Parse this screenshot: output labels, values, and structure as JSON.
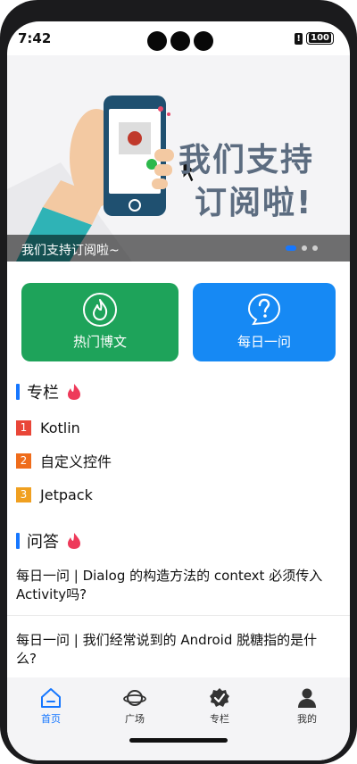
{
  "status_bar": {
    "time": "7:42",
    "battery": "100",
    "alert_icon": "!"
  },
  "banner": {
    "title_line1": "我们支持",
    "title_line2": "订阅啦!",
    "caption": "我们支持订阅啦~",
    "slide_count": 3,
    "active_slide": 1
  },
  "quick_actions": {
    "hot_label": "热门博文",
    "daily_label": "每日一问",
    "hot_color": "#1ea35a",
    "daily_color": "#1689f4",
    "hot_icon": "flame-icon",
    "daily_icon": "question-icon"
  },
  "columns": {
    "title": "专栏",
    "items": [
      {
        "rank": "1",
        "name": "Kotlin",
        "color": "#e94638"
      },
      {
        "rank": "2",
        "name": "自定义控件",
        "color": "#ef6c1b"
      },
      {
        "rank": "3",
        "name": "Jetpack",
        "color": "#f0a020"
      }
    ]
  },
  "qa": {
    "title": "问答",
    "items": [
      "每日一问 | Dialog 的构造方法的 context 必须传入 Activity吗?",
      "每日一问 | 我们经常说到的 Android 脱糖指的是什么?"
    ]
  },
  "tabbar": {
    "tabs": [
      {
        "label": "首页",
        "icon": "home-icon",
        "active": true
      },
      {
        "label": "广场",
        "icon": "planet-icon",
        "active": false
      },
      {
        "label": "专栏",
        "icon": "badge-check-icon",
        "active": false
      },
      {
        "label": "我的",
        "icon": "person-icon",
        "active": false
      }
    ],
    "accent": "#1677ff"
  }
}
